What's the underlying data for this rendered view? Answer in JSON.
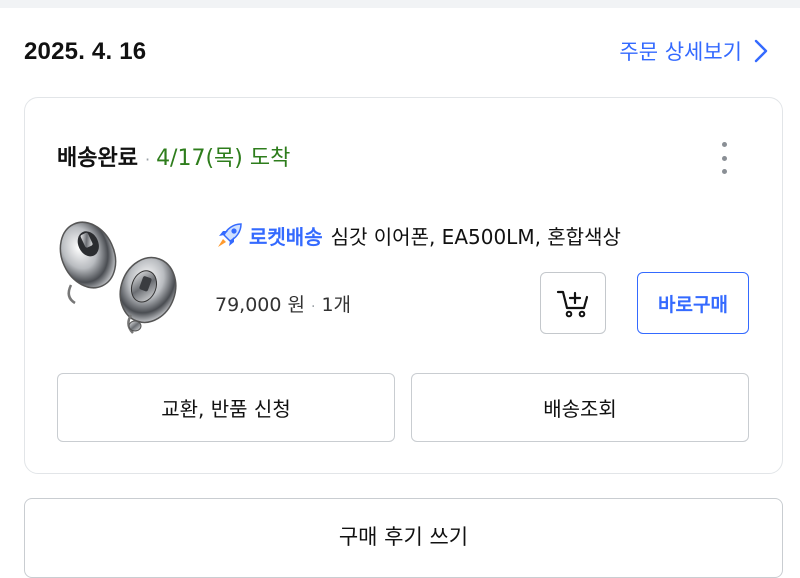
{
  "order": {
    "date": "2025. 4. 16",
    "detail_link_label": "주문 상세보기"
  },
  "card": {
    "status": "배송완료",
    "arrival": "4/17(목) 도착",
    "product": {
      "badge": "로켓배송",
      "name": "심갓 이어폰, EA500LM, 혼합색상",
      "price": "79,000 원",
      "quantity": "1개"
    },
    "buy_now_label": "바로구매",
    "exchange_return_label": "교환, 반품 신청",
    "tracking_label": "배송조회"
  },
  "review_label": "구매 후기 쓰기",
  "colors": {
    "accent": "#346aff",
    "arrival_green": "#2e7d1c",
    "border": "#e2e5e8"
  },
  "icons": {
    "chevron": "chevron-right-icon",
    "more": "more-vertical-icon",
    "rocket": "rocket-icon",
    "cart": "add-to-cart-icon"
  }
}
